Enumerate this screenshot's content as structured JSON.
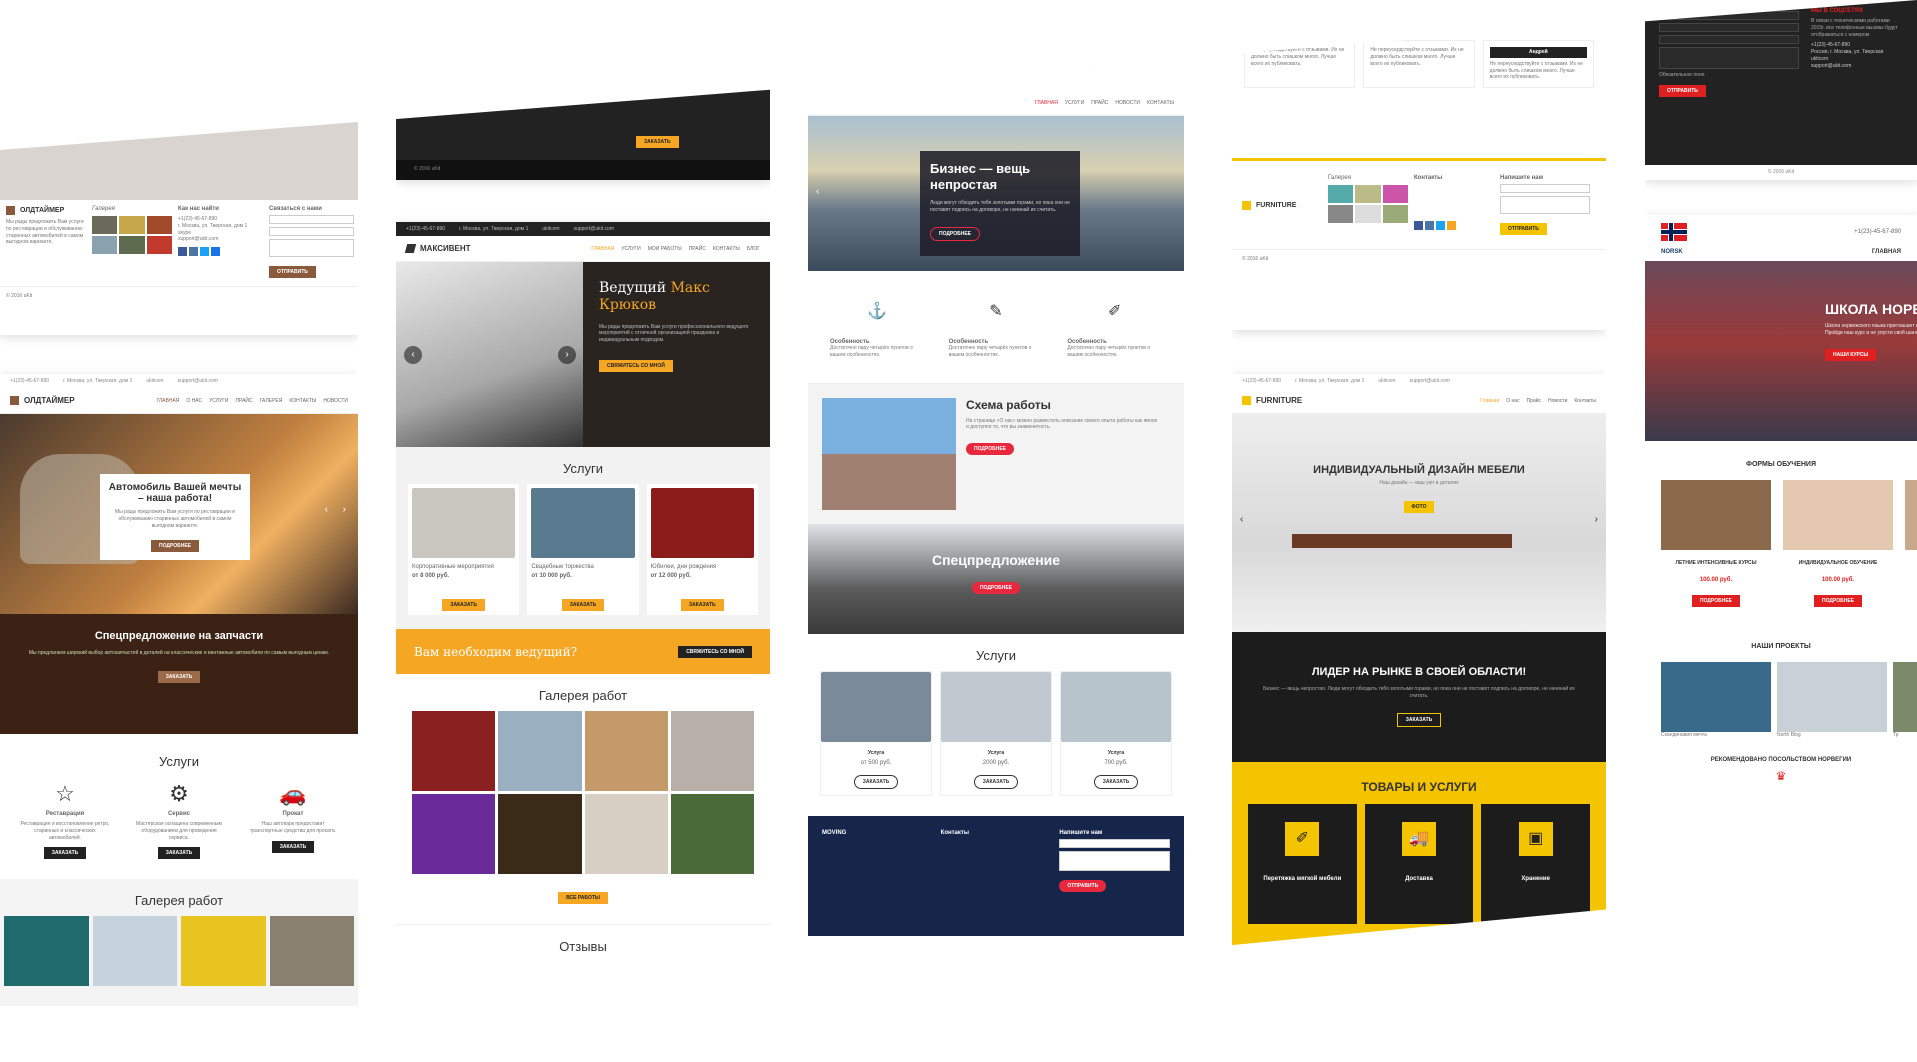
{
  "oldtimer": {
    "footer": {
      "brand": "ОЛДТАЙМЕР",
      "about": "Мы рады предложить Вам услуги по реставрации и обслуживанию старинных автомобилей в самом выгодном варианте.",
      "gallery_title": "Галерея",
      "find_title": "Как нас найти",
      "contacts": [
        "+1(23)-45-67-890",
        "г. Москва, ул. Тверская, дом 1",
        "skype",
        "support@ukit.com"
      ],
      "form_title": "Связаться с нами",
      "form_placeholders": [
        "Имя",
        "Email",
        "Сообщение"
      ],
      "send_btn": "ОТПРАВИТЬ",
      "copyright": "© 2016 uKit"
    },
    "topbar": [
      "+1(23)-45-67-890",
      "г. Москва, ул. Тверская, дом 1",
      "ukitcom",
      "support@ukit.com"
    ],
    "brand": "ОЛДТАЙМЕР",
    "menu": [
      "ГЛАВНАЯ",
      "О НАС",
      "УСЛУГИ",
      "ПРАЙС",
      "ГАЛЕРЕЯ",
      "КОНТАКТЫ",
      "НОВОСТИ"
    ],
    "hero_title": "Автомобиль Вашей мечты – наша работа!",
    "hero_text": "Мы рады предложить Вам услуги по реставрации и обслуживанию старинных автомобилей в самом выгодном варианте.",
    "hero_btn": "ПОДРОБНЕЕ",
    "special_title": "Спецпредложение на запчасти",
    "special_text": "Мы предлагаем широкий выбор автозапчастей в деталей на классические и винтажные автомобили по самым выгодным ценам.",
    "special_btn": "ЗАКАЗАТЬ",
    "services_title": "Услуги",
    "services": [
      {
        "name": "Реставрация",
        "text": "Реставрация и восстановление ретро, старинных и классических автомобилей.",
        "btn": "ЗАКАЗАТЬ"
      },
      {
        "name": "Сервис",
        "text": "Мастерская оснащена современным оборудованием для проведения сервиса.",
        "btn": "ЗАКАЗАТЬ"
      },
      {
        "name": "Прокат",
        "text": "Наш автопарк предоставит транспортные средства для проката.",
        "btn": "ЗАКАЗАТЬ"
      }
    ],
    "gallery_title": "Галерея работ"
  },
  "maksivent": {
    "prev_btn": "ЗАКАЗАТЬ",
    "prev_copyright": "© 2016 uKit",
    "topbar": [
      "+1(23)-45-67-890",
      "г. Москва, ул. Тверская, дом 1",
      "ukitcom",
      "support@ukit.com"
    ],
    "brand": "МАКСИВЕНТ",
    "menu": [
      "ГЛАВНАЯ",
      "УСЛУГИ",
      "МОИ РАБОТЫ",
      "ПРАЙС",
      "КОНТАКТЫ",
      "БЛОГ"
    ],
    "hero_title_a": "Ведущий ",
    "hero_title_b": "Макс",
    "hero_title_c": "Крюков",
    "hero_text": "Мы рады предложить Вам услуги профессионального ведущего мероприятий с отличной организацией праздника и индивидуальным подходом.",
    "hero_btn": "СВЯЖИТЕСЬ СО МНОЙ",
    "services_title": "Услуги",
    "services": [
      {
        "name": "Корпоративные мероприятия",
        "price": "от 8 000 руб.",
        "btn": "ЗАКАЗАТЬ"
      },
      {
        "name": "Свадебные торжества",
        "price": "от 10 000 руб.",
        "btn": "ЗАКАЗАТЬ"
      },
      {
        "name": "Юбилеи, дни рождения",
        "price": "от 12 000 руб.",
        "btn": "ЗАКАЗАТЬ"
      }
    ],
    "cta_text": "Вам необходим ведущий?",
    "cta_btn": "СВЯЖИТЕСЬ СО МНОЙ",
    "gallery_title": "Галерея работ",
    "gallery_btn": "ВСЕ РАБОТЫ",
    "reviews_title": "Отзывы"
  },
  "moving": {
    "menu": [
      "ГЛАВНАЯ",
      "УСЛУГИ",
      "ПРАЙС",
      "НОВОСТИ",
      "КОНТАКТЫ"
    ],
    "hero_title": "Бизнес — вещь непростая",
    "hero_text": "Люди могут обходить тебя золотыми горами, но пока они не поставят подпись на договоре, не начинай их считать.",
    "hero_btn": "ПОДРОБНЕЕ",
    "features": [
      {
        "name": "Особенность",
        "text": "Достаточно пару четырёх пунктов о вашем особенностях."
      },
      {
        "name": "Особенность",
        "text": "Достаточно пару четырёх пунктов о вашем особенностях."
      },
      {
        "name": "Особенность",
        "text": "Достаточно пару четырёх пунктов о вашем особенностях."
      }
    ],
    "scheme_title": "Схема работы",
    "scheme_text": "На странице «О нас» можно разместить описание своего опыта работы как явное и доступно то, что вы знаменитость.",
    "scheme_btn": "ПОДРОБНЕЕ",
    "special_title": "Спецпредложение",
    "special_btn": "ПОДРОБНЕЕ",
    "services_title": "Услуги",
    "services": [
      {
        "name": "Услуга",
        "price": "от 500 руб.",
        "btn": "ЗАКАЗАТЬ"
      },
      {
        "name": "Услуга",
        "price": "2000 руб.",
        "btn": "ЗАКАЗАТЬ"
      },
      {
        "name": "Услуга",
        "price": "700 руб.",
        "btn": "ЗАКАЗАТЬ"
      }
    ],
    "footer_brand": "MOVING",
    "footer_contacts_title": "Контакты",
    "footer_form_title": "Напишите нам",
    "footer_btn": "ОТПРАВИТЬ"
  },
  "furniture": {
    "reviews": [
      {
        "name": "",
        "text": "Не переусердствуйте с отзывами. Их не должно быть слишком много. Лучше всего их публиковать."
      },
      {
        "name": "",
        "text": "Не переусердствуйте с отзывами. Их не должно быть слишком много. Лучше всего их публиковать."
      },
      {
        "name": "Андрей",
        "text": "Не переусердствуйте с отзывами. Их не должно быть слишком много. Лучше всего их публиковать."
      }
    ],
    "footer_brand": "FURNITURE",
    "footer_gallery": "Галерея",
    "footer_contacts": "Контакты",
    "footer_form": "Напишите нам",
    "footer_btn": "ОТПРАВИТЬ",
    "copyright": "© 2016 uKit",
    "topbar": [
      "+1(23)-45-67-890",
      "г. Москва, ул. Тверская, дом 1",
      "ukitcom",
      "support@ukit.com"
    ],
    "brand": "FURNITURE",
    "menu": [
      "Главная",
      "О нас",
      "Прайс",
      "Новости",
      "Контакты"
    ],
    "hero_title": "ИНДИВИДУАЛЬНЫЙ ДИЗАЙН МЕБЕЛИ",
    "hero_sub": "Наш дизайн — ваш уют в деталях",
    "hero_btn": "ФОТО",
    "leader_title": "ЛИДЕР НА РЫНКЕ В СВОЕЙ ОБЛАСТИ!",
    "leader_text": "Бизнес — вещь непростая. Люди могут обходить тебя золотыми горами, но пока они не поставят подпись на договоре, не начинай их считать.",
    "leader_btn": "ЗАКАЗАТЬ",
    "goods_title": "ТОВАРЫ И УСЛУГИ",
    "goods": [
      "Перетяжка мягкой мебели",
      "Доставка",
      "Хранение"
    ]
  },
  "norsk": {
    "footer_title": "МЫ В СОЦСЕТЯХ",
    "footer_text": "В связи с техническими работами 2015г. все телефонные вызовы будут отображаться с номером",
    "footer_contacts": [
      "+1(23)-45-67-890",
      "Россия, г. Москва, ул. Тверская",
      "ukitcom",
      "support@ukit.com"
    ],
    "form_placeholders": [
      "Имя",
      "Электронная почта",
      "Телефон",
      "Сообщение"
    ],
    "required": "Обязательное поле",
    "send_btn": "ОТПРАВИТЬ",
    "copyright": "© 2016 uKit",
    "brand": "NORSK",
    "phone": "+1(23)-45-67-890",
    "menu_item": "ГЛАВНАЯ",
    "hero_title": "ШКОЛА НОРВЕЖСКОГО ЯЗЫКА",
    "hero_text": "Школа норвежского языка приглашает вас на курсы. Пройди наш курс и не упусти свой шанс!",
    "hero_btn": "НАШИ КУРСЫ",
    "forms_title": "ФОРМЫ ОБУЧЕНИЯ",
    "forms": [
      {
        "name": "ЛЕТНИЕ ИНТЕНСИВНЫЕ КУРСЫ",
        "price": "100.00 руб.",
        "btn": "ПОДРОБНЕЕ"
      },
      {
        "name": "ИНДИВИДУАЛЬНОЕ ОБУЧЕНИЕ",
        "price": "100.00 руб.",
        "btn": "ПОДРОБНЕЕ"
      },
      {
        "name": "ОБ",
        "price": "",
        "btn": ""
      }
    ],
    "projects_title": "НАШИ ПРОЕКТЫ",
    "projects": [
      "Скандинавия мечта",
      "North Blog",
      "Тр"
    ],
    "recommend": "РЕКОМЕНДОВАНО ПОСОЛЬСТВОМ НОРВЕГИИ"
  },
  "colors": {
    "oldtimer_accent": "#8a5a3c",
    "maksivent_accent": "#f5a623",
    "moving_accent": "#e8283c",
    "furniture_accent": "#f5c400",
    "norsk_accent": "#e02020"
  }
}
